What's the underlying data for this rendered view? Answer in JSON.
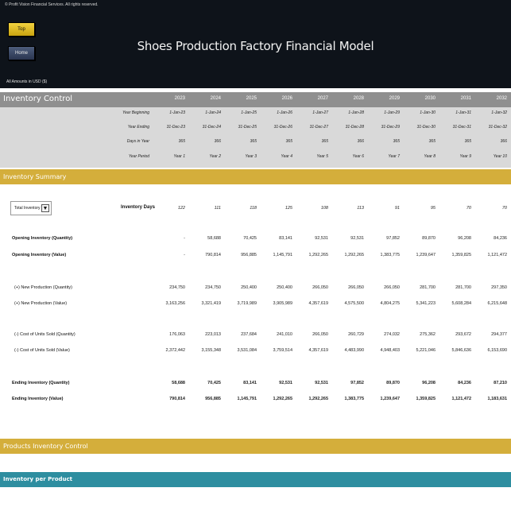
{
  "copyright": "© Profit Vision Financial Services. All rights reserved.",
  "nav": {
    "top_label": "Top",
    "home_label": "Home"
  },
  "title": "Shoes Production Factory Financial Model",
  "currency_note": "All Amounts in  USD ($)",
  "inventory_control": {
    "title": "Inventory Control",
    "years": [
      "2023",
      "2024",
      "2025",
      "2026",
      "2027",
      "2028",
      "2029",
      "2030",
      "2031",
      "2032"
    ],
    "info_rows": [
      {
        "label": "Year Beginning",
        "values": [
          "1-Jan-23",
          "1-Jan-24",
          "1-Jan-25",
          "1-Jan-26",
          "1-Jan-27",
          "1-Jan-28",
          "1-Jan-29",
          "1-Jan-30",
          "1-Jan-31",
          "1-Jan-32"
        ]
      },
      {
        "label": "Year Ending",
        "values": [
          "31-Dec-23",
          "31-Dec-24",
          "31-Dec-25",
          "31-Dec-26",
          "31-Dec-27",
          "31-Dec-28",
          "31-Dec-29",
          "31-Dec-30",
          "31-Dec-31",
          "31-Dec-32"
        ]
      },
      {
        "label": "Days in Year",
        "values": [
          "365",
          "366",
          "365",
          "365",
          "365",
          "366",
          "365",
          "365",
          "365",
          "366"
        ]
      },
      {
        "label": "Year Period",
        "values": [
          "Year 1",
          "Year 2",
          "Year 3",
          "Year 4",
          "Year 5",
          "Year 6",
          "Year 7",
          "Year 8",
          "Year 9",
          "Year 10"
        ]
      }
    ]
  },
  "inventory_summary": {
    "title": "Inventory Summary",
    "dropdown_value": "Total Inventory",
    "inventory_days_label": "Inventory Days",
    "inventory_days": [
      "122",
      "111",
      "118",
      "125",
      "108",
      "113",
      "91",
      "95",
      "70",
      "70"
    ],
    "rows": [
      {
        "label": "Opening Inventory (Quantity)",
        "bold": true,
        "values": [
          "-",
          "58,688",
          "70,425",
          "83,141",
          "92,531",
          "92,531",
          "97,852",
          "89,870",
          "96,208",
          "84,236"
        ]
      },
      {
        "label": "Opening Inventory (Value)",
        "bold": true,
        "values": [
          "-",
          "790,814",
          "956,885",
          "1,145,791",
          "1,292,265",
          "1,292,265",
          "1,383,775",
          "1,239,647",
          "1,359,825",
          "1,121,472"
        ]
      },
      {
        "label": "(+) New Production (Quantity)",
        "bold": false,
        "values": [
          "234,750",
          "234,750",
          "250,400",
          "250,400",
          "266,050",
          "266,050",
          "266,050",
          "281,700",
          "281,700",
          "297,350"
        ]
      },
      {
        "label": "(+) New Production (Value)",
        "bold": false,
        "values": [
          "3,163,256",
          "3,321,419",
          "3,719,989",
          "3,905,989",
          "4,357,619",
          "4,575,500",
          "4,804,275",
          "5,341,223",
          "5,608,284",
          "6,215,648"
        ]
      },
      {
        "label": "(-) Cost of Units Sold (Quantity)",
        "bold": false,
        "values": [
          "176,063",
          "223,013",
          "237,684",
          "241,010",
          "266,050",
          "260,729",
          "274,032",
          "275,362",
          "293,672",
          "294,377"
        ]
      },
      {
        "label": "(-) Cost of Units Sold (Value)",
        "bold": false,
        "values": [
          "2,372,442",
          "3,155,348",
          "3,531,084",
          "3,759,514",
          "4,357,619",
          "4,483,990",
          "4,948,403",
          "5,221,046",
          "5,846,636",
          "6,153,690"
        ]
      },
      {
        "label": "Ending Inventory (Quantity)",
        "bold": true,
        "values": [
          "58,688",
          "70,425",
          "83,141",
          "92,531",
          "92,531",
          "97,852",
          "89,870",
          "96,208",
          "84,236",
          "87,210"
        ]
      },
      {
        "label": "Ending Inventory (Value)",
        "bold": true,
        "values": [
          "790,814",
          "956,885",
          "1,145,791",
          "1,292,265",
          "1,292,265",
          "1,383,775",
          "1,239,647",
          "1,359,825",
          "1,121,472",
          "1,183,631"
        ]
      }
    ]
  },
  "products_inventory_control": {
    "title": "Products Inventory Control"
  },
  "inventory_per_product": {
    "title": "Inventory per Product"
  },
  "colors": {
    "gold": "#d4ae3b",
    "teal": "#2e8ea0",
    "grey_header": "#8f8f8f",
    "info_band": "#d9d9d9",
    "background": "#0e131a"
  }
}
